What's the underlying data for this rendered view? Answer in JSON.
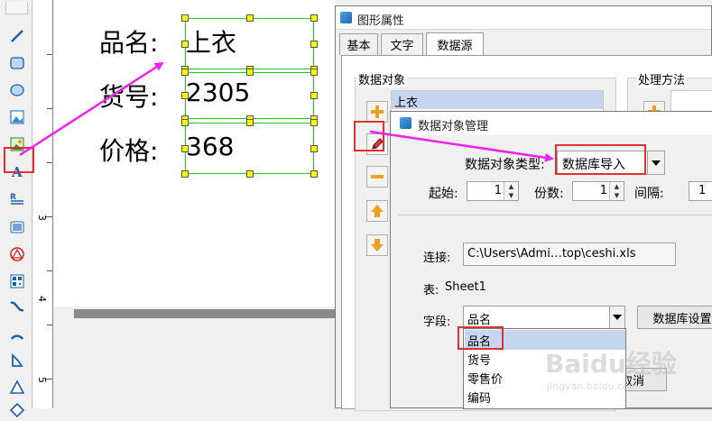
{
  "ruler": {
    "marks": [
      "3",
      "4",
      "5"
    ]
  },
  "canvas": {
    "rows": [
      {
        "label": "品名:",
        "value": "上衣"
      },
      {
        "label": "货号:",
        "value": "2305"
      },
      {
        "label": "价格:",
        "value": "368"
      }
    ]
  },
  "toolbar": {
    "icons": [
      "line-tool-icon",
      "rounded-rect-tool-icon",
      "ellipse-tool-icon",
      "image-tool-icon",
      "picture-tool-icon",
      "text-tool-icon",
      "rich-text-tool-icon",
      "barcode-tool-icon",
      "shape-tool-icon",
      "qrcode-tool-icon",
      "curve-tool-icon",
      "arc-tool-icon",
      "polyline-tool-icon",
      "triangle-tool-icon",
      "diamond-tool-icon"
    ]
  },
  "properties_dialog": {
    "title": "图形属性",
    "tabs": [
      "基本",
      "文字",
      "数据源"
    ],
    "active_tab": "数据源",
    "data_objects_label": "数据对象",
    "data_objects": [
      "上衣"
    ],
    "processing_label": "处理方法"
  },
  "manager_dialog": {
    "title": "数据对象管理",
    "type_label": "数据对象类型:",
    "type_value": "数据库导入",
    "start_label": "起始:",
    "start_value": "1",
    "copies_label": "份数:",
    "copies_value": "1",
    "interval_label": "间隔:",
    "interval_value": "1",
    "connection_label": "连接:",
    "connection_value": "C:\\Users\\Admi…top\\ceshi.xls",
    "table_label": "表:",
    "table_value": "Sheet1",
    "field_label": "字段:",
    "field_value": "品名",
    "db_settings_label": "数据库设置",
    "cancel_label": "取消",
    "field_options": [
      "品名",
      "货号",
      "零售价",
      "编码"
    ]
  },
  "watermark": {
    "text": "Baidu经验",
    "sub": "jingyan.baidu.com"
  },
  "colors": {
    "highlight": "#e03030",
    "arrow": "#ee22ee",
    "selection_box": "#24c624",
    "handle": "#ffff00",
    "list_selected": "#c6d6ef"
  }
}
